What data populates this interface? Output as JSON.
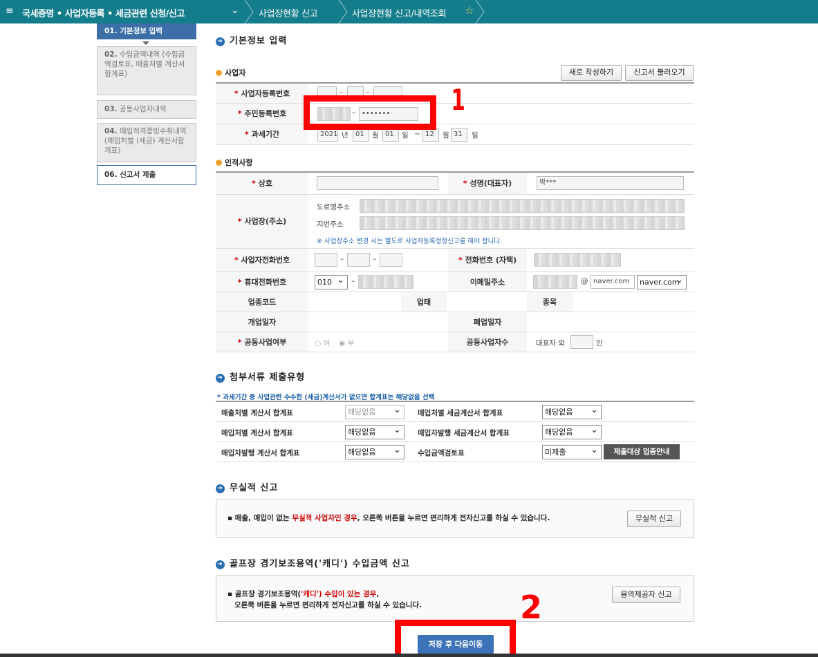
{
  "topbar": {
    "menu_icon": "menu-icon",
    "title": "국세증명 • 사업자등록 • 세금관련 신청/신고",
    "chevron": "⌄",
    "crumb1": "사업장현황 신고",
    "crumb2": "사업장현황 신고/내역조회",
    "star": "☆"
  },
  "steps": [
    {
      "label": "01. 기본정보 입력"
    },
    {
      "label": "02.",
      "sub": "수입금액내역 (수입금액검토표, 매출처별 계산서 합계표)"
    },
    {
      "label": "03.",
      "sub": "공동사업자내역"
    },
    {
      "label": "04.",
      "sub": "매입적격증빙수취내역 (매입처별 (세금) 계산서합계표)"
    },
    {
      "label": "06. 신고서 제출"
    }
  ],
  "basic": {
    "heading": "기본정보 입력",
    "section_business": "사업자",
    "btn_new": "새로 작성하기",
    "btn_load": "신고서 불러오기",
    "brn_label": "사업자등록번호",
    "rrn_label": "주민등록번호",
    "rrn_masked": "•••••••",
    "period_label": "과세기간",
    "period": {
      "y1": "2021",
      "m1": "01",
      "d1": "01",
      "m2": "12",
      "d2": "31",
      "u_year": "년",
      "u_month": "월",
      "u_day": "일",
      "tilde": "~"
    }
  },
  "person": {
    "section": "인적사항",
    "trade_name": "상호",
    "rep_name_label": "성명(대표자)",
    "rep_name": "박***",
    "addr_label": "사업장(주소)",
    "road_label": "도로명주소",
    "lot_label": "지번주소",
    "addr_note": "※ 사업장주소 변경 시는 별도로 사업자등록정정신고를 해야 합니다.",
    "biz_phone": "사업자전화번호",
    "home_phone_label": "전화번호 (자택)",
    "mobile_label": "휴대전화번호",
    "mobile_prefix": "010",
    "email_label": "이메일주소",
    "email_at": "@",
    "email_domain": "naver.com",
    "email_select": "naver.com",
    "industry_code": "업종코드",
    "category": "업태",
    "item": "종목",
    "open_date": "개업일자",
    "close_date": "폐업일자",
    "joint_label": "공동사업여부",
    "joint_yes": "여",
    "joint_no": "부",
    "joint_count_label": "공동사업자수",
    "joint_prefix": "대표자 외",
    "joint_suffix": "인"
  },
  "attach": {
    "heading": "첨부서류 제출유형",
    "note": "* 과세기간 중 사업관련 수수한 (세금)계산서가 없으면 합계표는 해당없음 선택",
    "rows": [
      {
        "l1": "매출처별 계산서 합계표",
        "v1": "해당없음",
        "l2": "매입처별 세금계산서 합계표",
        "v2": "해당없음"
      },
      {
        "l1": "매입처별 계산서 합계표",
        "v1": "해당없음",
        "l2": "매입자발행 세금계산서 합계표",
        "v2": "해당없음"
      },
      {
        "l1": "매입자발행 계산서 합계표",
        "v1": "해당없음",
        "l2": "수입금액검토표",
        "v2": "미제출"
      }
    ],
    "guide_btn": "제출대상 업종안내"
  },
  "nil": {
    "heading": "무실적 신고",
    "text_a": "▪ 매출, 매입이 없는 ",
    "text_b": "무실적 사업자인 경우",
    "text_c": ", 오른쪽 버튼을 누르면 편리하게 전자신고를 하실 수 있습니다.",
    "btn": "무실적 신고"
  },
  "caddie": {
    "heading": "골프장 경기보조용역('캐디') 수입금액 신고",
    "text_a": "▪ 골프장 경기보조용역(",
    "text_b": "'캐디') 수입이 있는 경우",
    "text_c": ",",
    "text_d": "오른쪽 버튼을 누르면 편리하게 전자신고를 하실 수 있습니다.",
    "btn": "용역제공자 신고"
  },
  "save_btn": "저장 후 다음이동",
  "annot": {
    "one": "1",
    "two": "2"
  },
  "colors": {
    "topbar": "#137d8c",
    "accent": "#3c6fa8",
    "annotation": "#ff0000",
    "required": "#cc0000"
  }
}
